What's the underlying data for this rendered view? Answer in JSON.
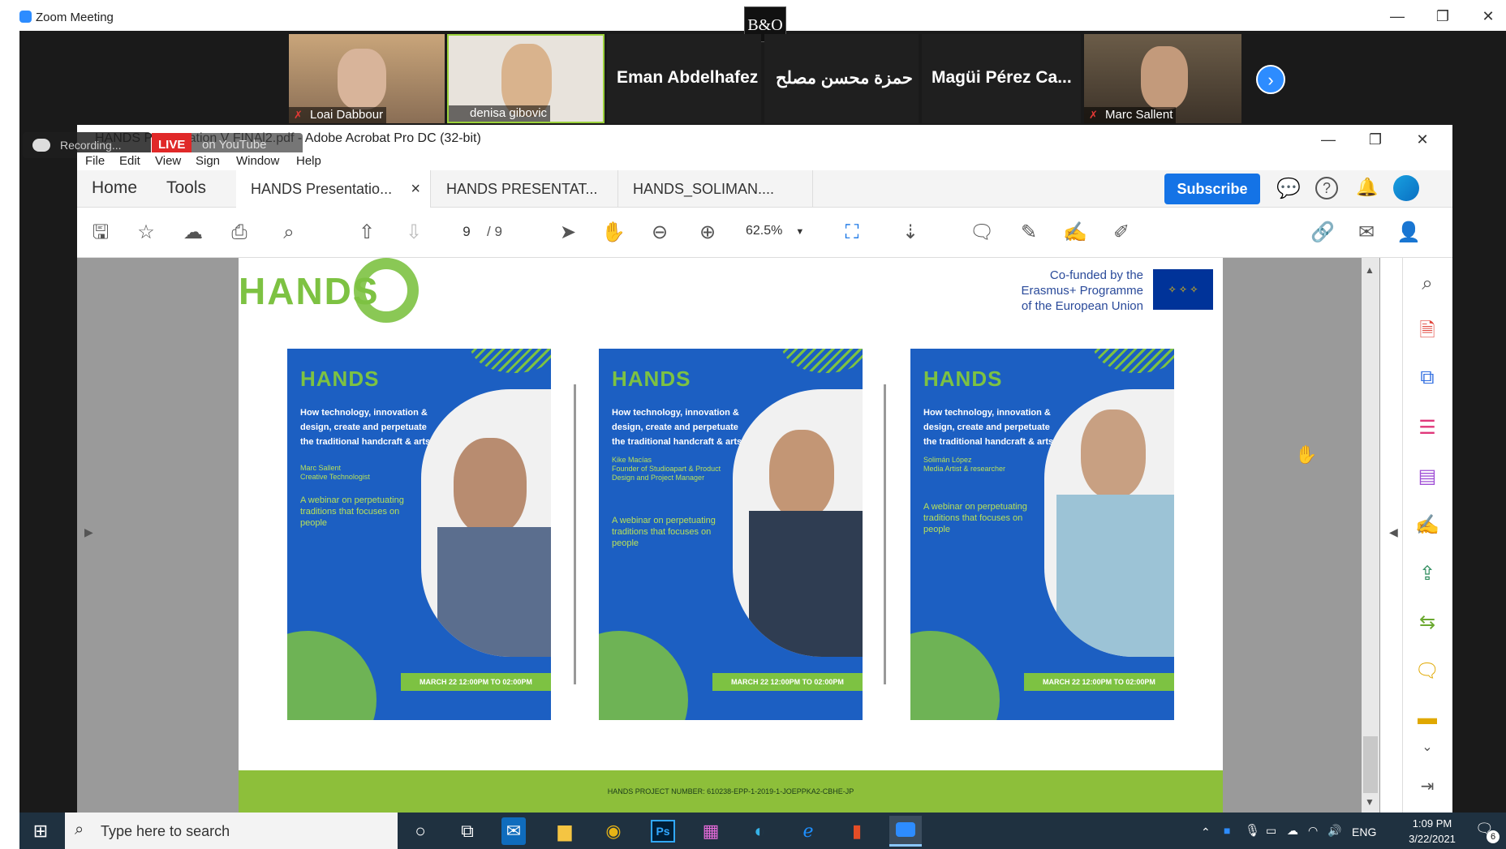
{
  "zoom": {
    "window_title": "Zoom Meeting",
    "bo_logo": "B&O",
    "participants": [
      {
        "name": "Loai Dabbour",
        "has_video": true
      },
      {
        "name": "denisa gibovic",
        "has_video": true
      },
      {
        "name": "Eman Abdelhafez",
        "has_video": false
      },
      {
        "name": "حمزة محسن مصلح",
        "has_video": false
      },
      {
        "name": "Magüi Pérez Ca...",
        "has_video": false
      },
      {
        "name": "Marc Sallent",
        "has_video": true
      }
    ],
    "recording_label": "Recording...",
    "live_badge": "LIVE",
    "live_text": "on YouTube"
  },
  "acrobat": {
    "title": "HANDS Presentation V FINAl2.pdf - Adobe Acrobat Pro DC (32-bit)",
    "menu": [
      "File",
      "Edit",
      "View",
      "Sign",
      "Window",
      "Help"
    ],
    "nav": {
      "home": "Home",
      "tools": "Tools"
    },
    "tabs": [
      "HANDS Presentatio...",
      "HANDS PRESENTAT...",
      "HANDS_SOLIMAN...."
    ],
    "tab_close": "×",
    "subscribe": "Subscribe",
    "page_current": "9",
    "page_total": "/ 9",
    "zoom_level": "62.5%"
  },
  "slide": {
    "logo_text": "HANDS",
    "cofunded_lines": [
      "Co-funded by the",
      "Erasmus+ Programme",
      "of the European Union"
    ],
    "posters": [
      {
        "logo": "HANDS",
        "headline": "How technology, innovation & design, create and perpetuate the traditional handcraft & arts",
        "speaker": "Marc Sallent",
        "role": "Creative Technologist",
        "subtitle": "A webinar on perpetuating traditions that focuses on people",
        "date": "MARCH 22 12:00PM TO 02:00PM"
      },
      {
        "logo": "HANDS",
        "headline": "How technology, innovation & design, create and perpetuate the traditional handcraft & arts",
        "speaker": "Kike Macías",
        "role": "Founder of Studioapart & Product Design and Project Manager",
        "subtitle": "A webinar on perpetuating traditions that focuses on people",
        "date": "MARCH 22 12:00PM TO 02:00PM"
      },
      {
        "logo": "HANDS",
        "headline": "How technology, innovation & design, create and perpetuate the traditional handcraft & arts",
        "speaker": "Solimán López",
        "role": "Media Artist & researcher",
        "subtitle": "A webinar on perpetuating traditions that focuses on people",
        "date": "MARCH 22 12:00PM TO 02:00PM"
      }
    ],
    "project_number": "HANDS PROJECT NUMBER: 610238-EPP-1-2019-1-JOEPPKA2-CBHE-JP"
  },
  "taskbar": {
    "search_placeholder": "Type here to search",
    "language": "ENG",
    "time": "1:09 PM",
    "date": "3/22/2021",
    "notification_count": "6"
  },
  "colors": {
    "zoom_blue": "#2d8cff",
    "subscribe_blue": "#1473e6",
    "poster_blue": "#1c5fc2",
    "hands_green": "#7dc242",
    "live_red": "#e02828"
  }
}
